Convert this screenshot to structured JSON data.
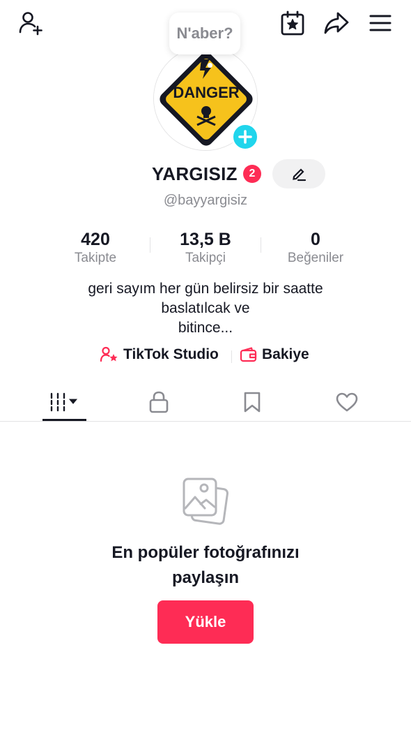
{
  "header": {
    "add_friend_icon": "person-plus-icon",
    "calendar_icon": "calendar-star-icon",
    "share_icon": "share-arrow-icon",
    "menu_icon": "hamburger-menu-icon"
  },
  "bubble": {
    "text": "N'aber?"
  },
  "profile": {
    "avatar_image_text": "DANGER",
    "username": "YARGISIZ",
    "notification_count": "2",
    "handle": "@bayyargisiz"
  },
  "stats": [
    {
      "value": "420",
      "label": "Takipte"
    },
    {
      "value": "13,5 B",
      "label": "Takipçi"
    },
    {
      "value": "0",
      "label": "Beğeniler"
    }
  ],
  "bio": {
    "lines": [
      "geri sayım her gün belirsiz bir saatte",
      "baslatılcak ve",
      "bitince..."
    ]
  },
  "links": {
    "studio": "TikTok Studio",
    "balance": "Bakiye"
  },
  "tabs": [
    "videos",
    "private",
    "saved",
    "liked"
  ],
  "empty_state": {
    "title_line1": "En popüler fotoğrafınızı",
    "title_line2": "paylaşın",
    "button": "Yükle"
  },
  "colors": {
    "accent": "#fe2c55",
    "avatar_plus": "#20d5ec",
    "secondary_text": "#8a8b91"
  }
}
